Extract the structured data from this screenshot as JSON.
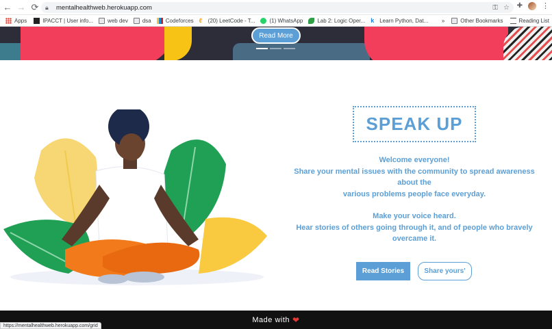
{
  "browser": {
    "url": "mentalhealthweb.herokuapp.com",
    "status_url": "https://mentalhealthweb.herokuapp.com/grid"
  },
  "bookmarks": {
    "items": [
      {
        "label": "Apps",
        "icon": "apps-grid-icon"
      },
      {
        "label": "IPACCT | User info...",
        "icon": "ip-favicon"
      },
      {
        "label": "web dev",
        "icon": "folder-icon"
      },
      {
        "label": "dsa",
        "icon": "folder-icon"
      },
      {
        "label": "Codeforces",
        "icon": "codeforces-icon"
      },
      {
        "label": "(20) LeetCode - T...",
        "icon": "leetcode-icon"
      },
      {
        "label": "(1) WhatsApp",
        "icon": "whatsapp-icon"
      },
      {
        "label": "Lab 2: Logic Oper...",
        "icon": "leaf-icon"
      },
      {
        "label": "Learn Python, Dat...",
        "icon": "k-icon"
      }
    ],
    "overflow": "»",
    "other": "Other Bookmarks",
    "reading_list": "Reading List"
  },
  "hero": {
    "read_more": "Read More"
  },
  "main": {
    "title": "SPEAK UP",
    "welcome": "Welcome everyone!",
    "line1": "Share your mental issues with the community to spread awareness about the",
    "line2": "various problems people face everyday.",
    "line3": "Make your voice heard.",
    "line4": "Hear stories of others going through it, and of people who bravely overcame it.",
    "read_stories": "Read Stories",
    "share_yours": "Share yours'"
  },
  "footer": {
    "made_with": "Made with"
  },
  "colors": {
    "accent": "#5b9fd6",
    "footer_bg": "#111111",
    "heart": "#e53935"
  }
}
